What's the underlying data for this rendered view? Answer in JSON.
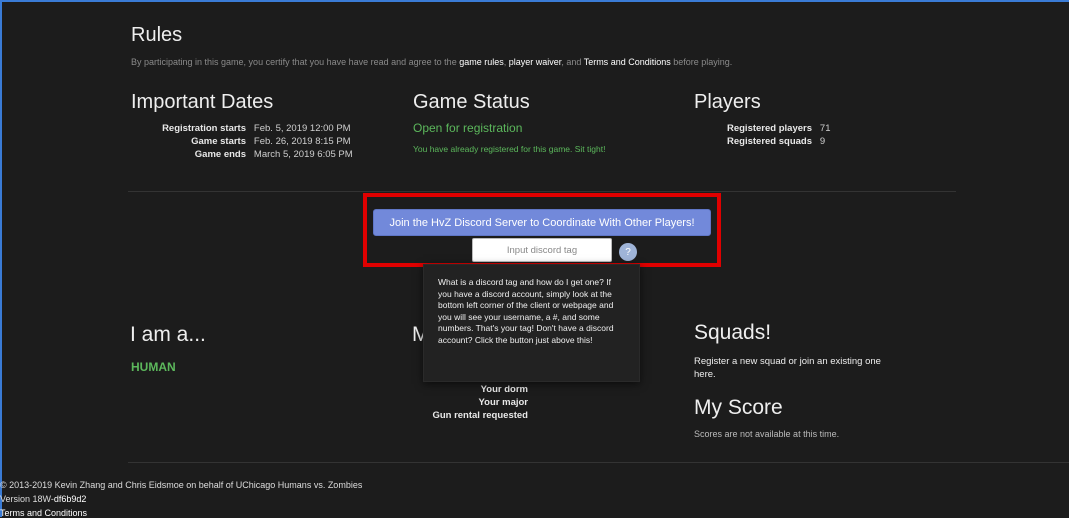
{
  "rules": {
    "title": "Rules",
    "text_before": "By participating in this game, you certify that you have have read and agree to the",
    "link1": "game rules",
    "sep1": ",",
    "link2": "player waiver",
    "sep2": ", and",
    "link3": "Terms and Conditions",
    "text_after": "before playing."
  },
  "dates": {
    "title": "Important Dates",
    "rows": [
      {
        "label": "Registration starts",
        "value": "Feb. 5, 2019 12:00 PM"
      },
      {
        "label": "Game starts",
        "value": "Feb. 26, 2019 8:15 PM"
      },
      {
        "label": "Game ends",
        "value": "March 5, 2019 6:05 PM"
      }
    ]
  },
  "game_status": {
    "title": "Game Status",
    "status": "Open for registration",
    "note": "You have already registered for this game. Sit tight!"
  },
  "players": {
    "title": "Players",
    "rows": [
      {
        "label": "Registered players",
        "value": "71"
      },
      {
        "label": "Registered squads",
        "value": "9"
      }
    ]
  },
  "discord": {
    "button_label": "Join the HvZ Discord Server to Coordinate With Other Players!",
    "input_placeholder": "Input discord tag",
    "help_glyph": "?",
    "tooltip": "What is a discord tag and how do I get one? If you have a discord account, simply look at the bottom left corner of the client or webpage and you will see your username, a #, and some numbers. That's your tag! Don't have a discord account? Click the button just above this!"
  },
  "iam": {
    "title": "I am a...",
    "role": "HUMAN"
  },
  "my_info": {
    "title_initial": "M",
    "rows": [
      "Your dorm",
      "Your major",
      "Gun rental requested"
    ]
  },
  "squads": {
    "title": "Squads!",
    "text": "Register a new squad or join an existing one here."
  },
  "score": {
    "title": "My Score",
    "text": "Scores are not available at this time."
  },
  "footer": {
    "copyright": "© 2013-2019 Kevin Zhang and Chris Eidsmoe on behalf of UChicago Humans vs. Zombies",
    "version_label": "Version 18W-",
    "version_hash": "df6b9d2",
    "terms": "Terms and Conditions"
  },
  "colors": {
    "background": "#1c1c1c",
    "accent_green": "#5cb85c",
    "discord_blue": "#7289da",
    "highlight_red": "#e00000"
  }
}
